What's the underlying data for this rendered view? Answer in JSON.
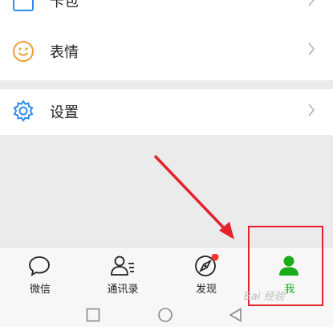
{
  "menu": {
    "top_item": {
      "label": "卡包",
      "icon": "card-icon"
    },
    "emoji_item": {
      "label": "表情",
      "icon": "smiley-icon"
    },
    "settings_item": {
      "label": "设置",
      "icon": "gear-icon"
    }
  },
  "tabs": [
    {
      "label": "微信",
      "icon": "chat-bubble-icon"
    },
    {
      "label": "通讯录",
      "icon": "contacts-icon"
    },
    {
      "label": "发现",
      "icon": "compass-icon",
      "badge": "red-dot"
    },
    {
      "label": "我",
      "icon": "person-icon",
      "active": true
    }
  ],
  "colors": {
    "accent_green": "#1aad19",
    "annotation_red": "#e5222b",
    "settings_blue": "#2d8ef0",
    "emoji_orange": "#e9a23b"
  },
  "watermark": "Bai 经验"
}
